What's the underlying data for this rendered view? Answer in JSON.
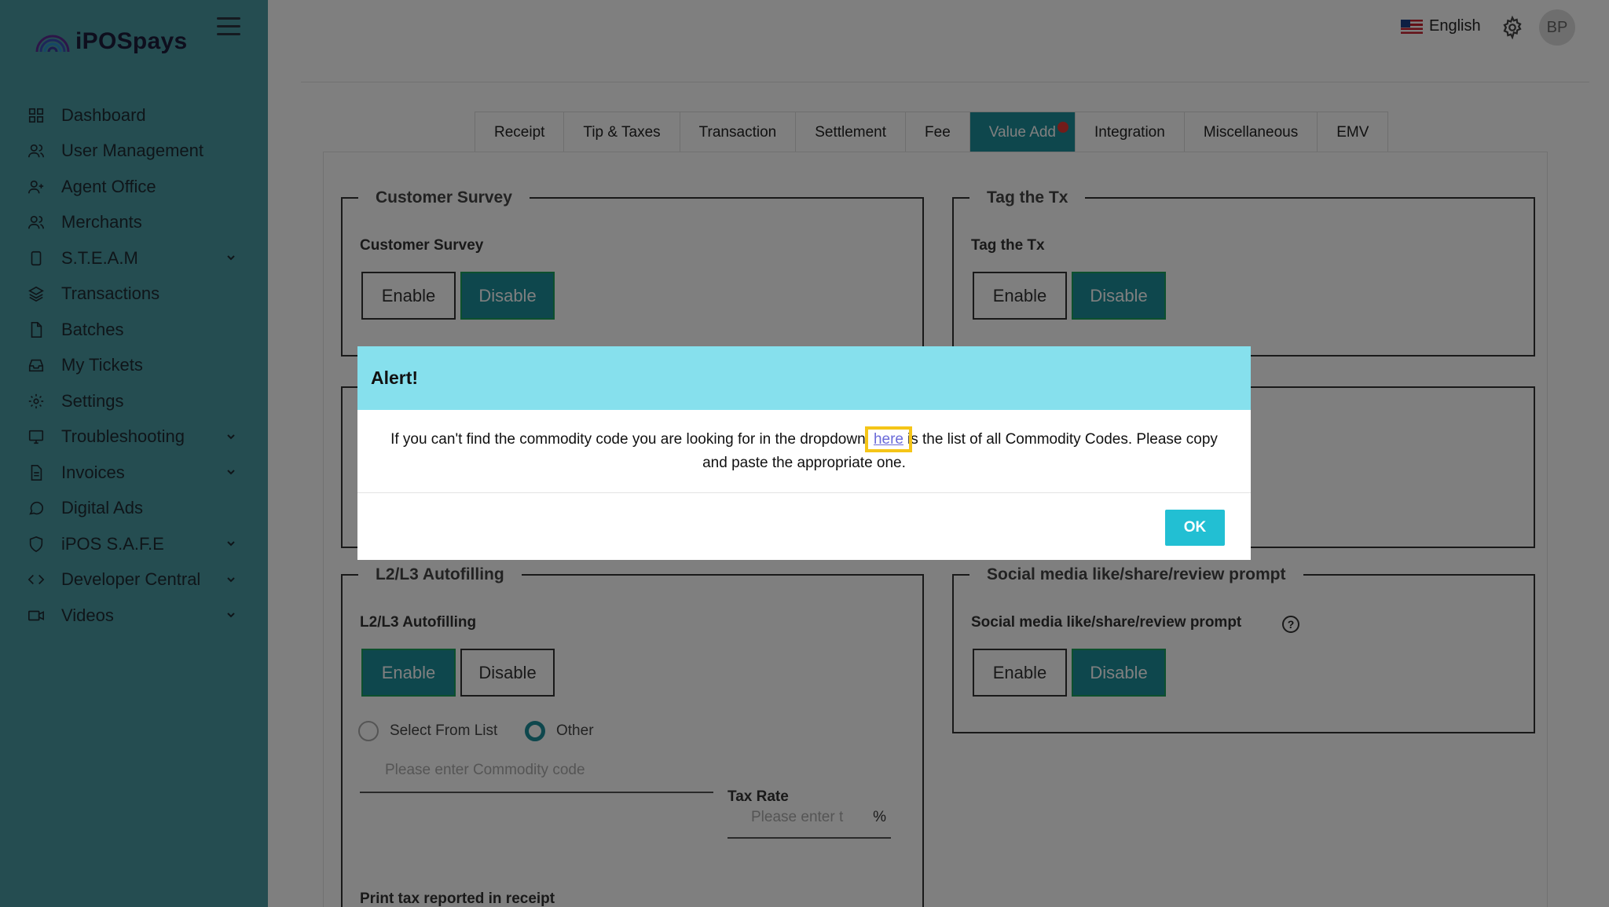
{
  "brand": {
    "name": "iPOSpays"
  },
  "sidebar": {
    "items": [
      {
        "label": "Dashboard",
        "icon": "dashboard-icon",
        "expandable": false
      },
      {
        "label": "User Management",
        "icon": "users-icon",
        "expandable": false
      },
      {
        "label": "Agent Office",
        "icon": "user-plus-icon",
        "expandable": false
      },
      {
        "label": "Merchants",
        "icon": "users-icon",
        "expandable": false
      },
      {
        "label": "S.T.E.A.M",
        "icon": "tablet-icon",
        "expandable": true
      },
      {
        "label": "Transactions",
        "icon": "layers-icon",
        "expandable": false
      },
      {
        "label": "Batches",
        "icon": "file-icon",
        "expandable": false
      },
      {
        "label": "My Tickets",
        "icon": "inbox-icon",
        "expandable": false
      },
      {
        "label": "Settings",
        "icon": "gear-icon",
        "expandable": false
      },
      {
        "label": "Troubleshooting",
        "icon": "monitor-icon",
        "expandable": true
      },
      {
        "label": "Invoices",
        "icon": "document-icon",
        "expandable": true
      },
      {
        "label": "Digital Ads",
        "icon": "chat-icon",
        "expandable": false
      },
      {
        "label": "iPOS S.A.F.E",
        "icon": "shield-icon",
        "expandable": true
      },
      {
        "label": "Developer Central",
        "icon": "code-icon",
        "expandable": true
      },
      {
        "label": "Videos",
        "icon": "video-icon",
        "expandable": true
      }
    ]
  },
  "topbar": {
    "language": "English",
    "avatar_initials": "BP"
  },
  "tabs": [
    {
      "label": "Receipt",
      "active": false
    },
    {
      "label": "Tip & Taxes",
      "active": false
    },
    {
      "label": "Transaction",
      "active": false
    },
    {
      "label": "Settlement",
      "active": false
    },
    {
      "label": "Fee",
      "active": false
    },
    {
      "label": "Value Add",
      "active": true
    },
    {
      "label": "Integration",
      "active": false
    },
    {
      "label": "Miscellaneous",
      "active": false
    },
    {
      "label": "EMV",
      "active": false
    }
  ],
  "sections": {
    "customer_survey": {
      "legend": "Customer Survey",
      "label": "Customer Survey",
      "enable": "Enable",
      "disable": "Disable",
      "selected": "Disable"
    },
    "tag_tx": {
      "legend": "Tag the Tx",
      "label": "Tag the Tx",
      "enable": "Enable",
      "disable": "Disable",
      "selected": "Disable"
    },
    "l2l3": {
      "legend": "L2/L3 Autofilling",
      "label": "L2/L3 Autofilling",
      "enable": "Enable",
      "disable": "Disable",
      "selected": "Enable",
      "radio_list": "Select From List",
      "radio_other": "Other",
      "radio_selected": "Other",
      "commodity_placeholder": "Please enter Commodity code",
      "tax_rate_label": "Tax Rate",
      "tax_rate_placeholder": "Please enter t",
      "tax_rate_unit": "%",
      "print_tax_label": "Print tax reported in receipt"
    },
    "social": {
      "legend": "Social media like/share/review prompt",
      "label": "Social media like/share/review prompt",
      "enable": "Enable",
      "disable": "Disable",
      "selected": "Disable"
    }
  },
  "modal": {
    "title": "Alert!",
    "message_before": "If you can't find the commodity code you are looking for in the dropdown",
    "link_text": "here",
    "message_after": "is the list of all Commodity Codes. Please copy and paste the appropriate one.",
    "ok_label": "OK"
  },
  "colors": {
    "sidebar": "#4a9aa2",
    "accent": "#1d8f9a",
    "modal_header": "#86e0ed",
    "ok_button": "#22bfd3",
    "highlight": "#f5c518"
  }
}
